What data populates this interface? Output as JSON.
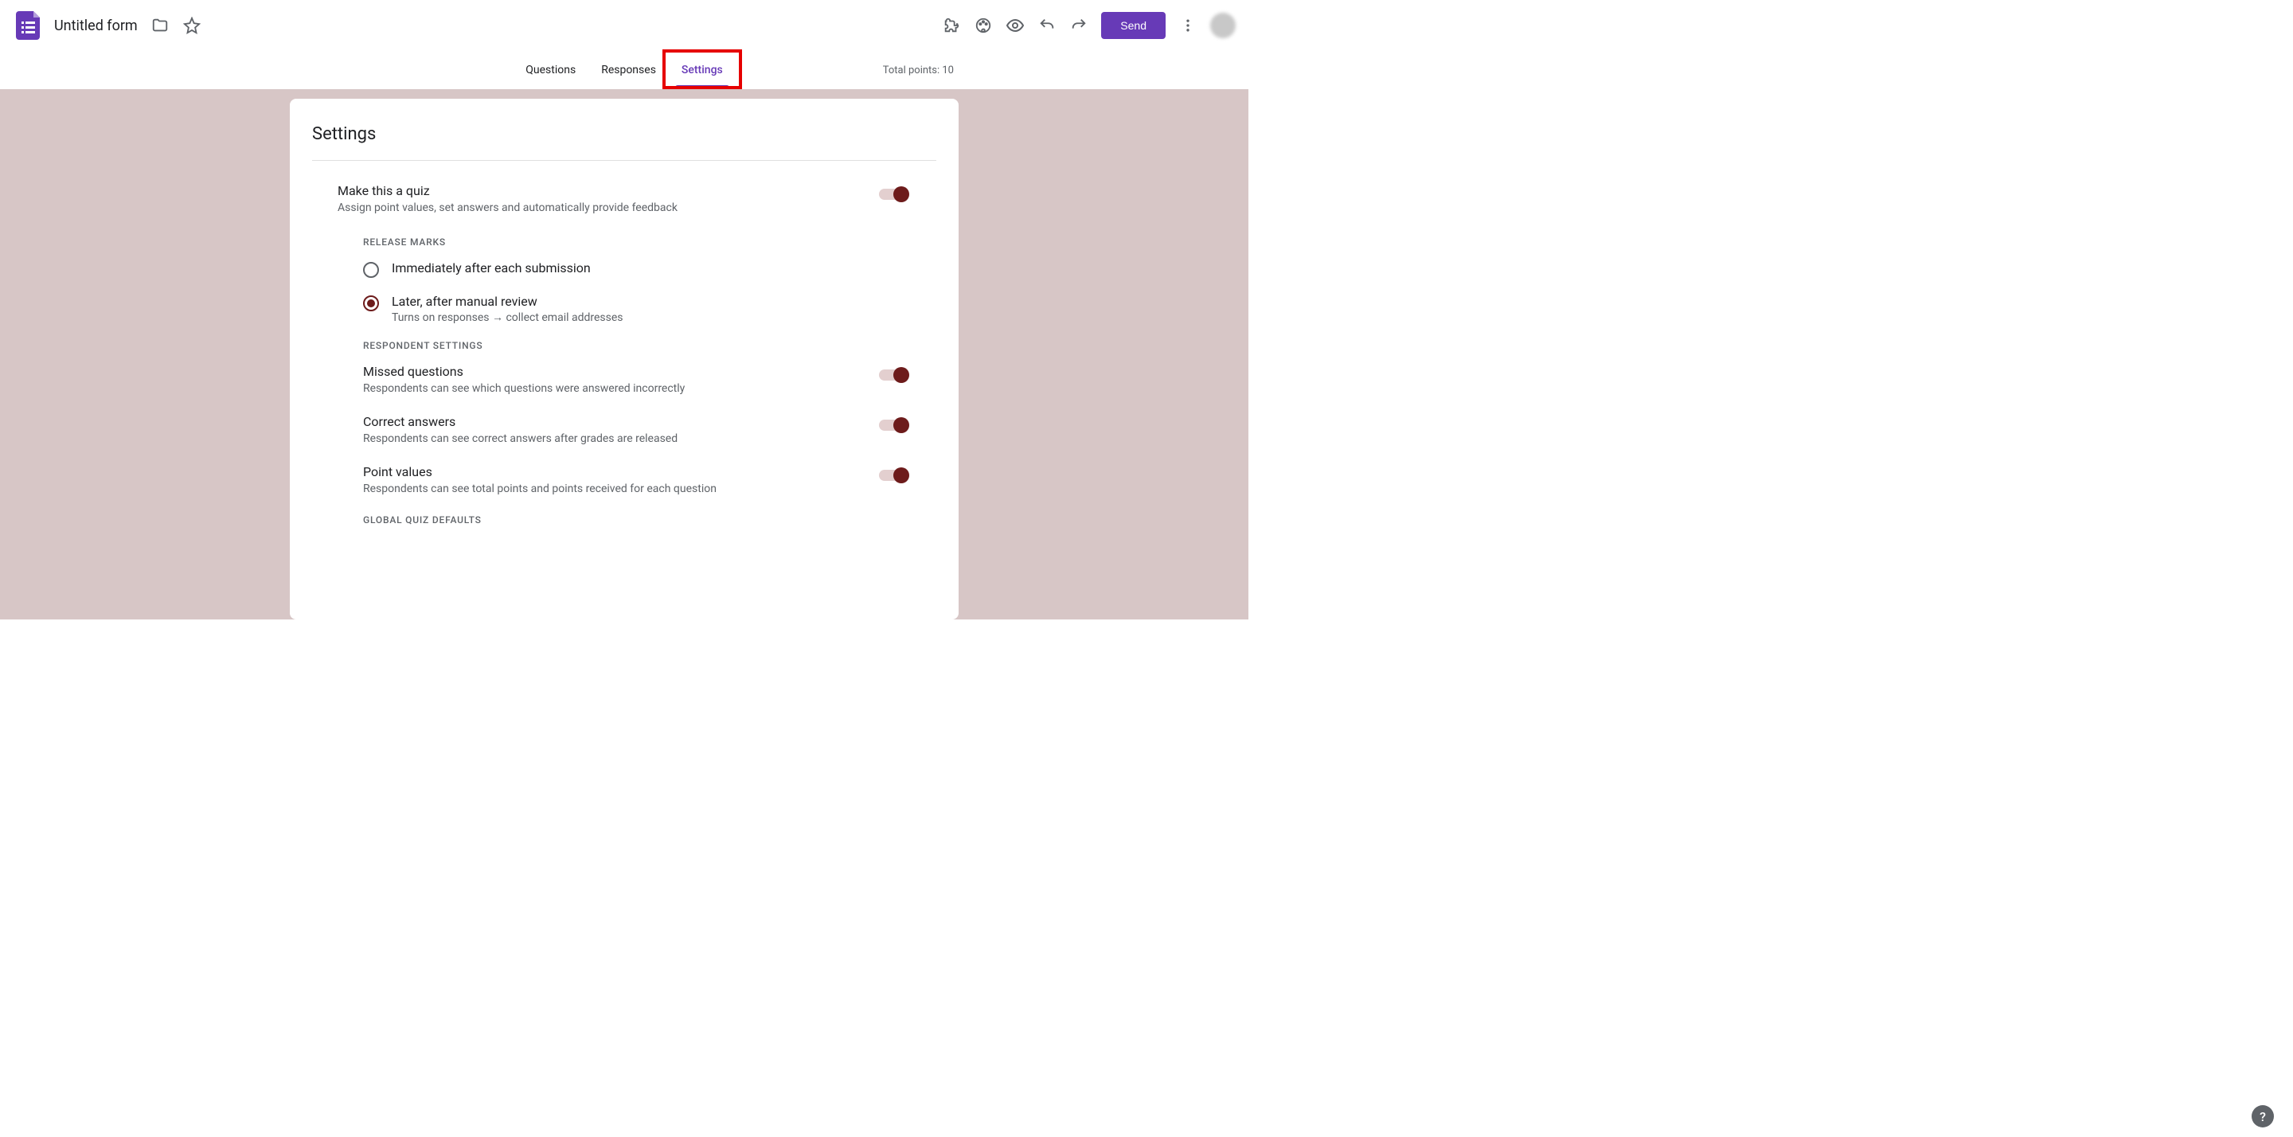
{
  "header": {
    "form_title": "Untitled form",
    "send_label": "Send"
  },
  "tabs": {
    "questions": "Questions",
    "responses": "Responses",
    "settings": "Settings"
  },
  "total_points_label": "Total points: 10",
  "settings_card": {
    "title": "Settings",
    "quiz": {
      "title": "Make this a quiz",
      "desc": "Assign point values, set answers and automatically provide feedback"
    },
    "release_marks_label": "RELEASE MARKS",
    "release_options": {
      "immediately": "Immediately after each submission",
      "later": "Later, after manual review",
      "later_desc": "Turns on responses → collect email addresses"
    },
    "respondent_label": "RESPONDENT SETTINGS",
    "missed": {
      "title": "Missed questions",
      "desc": "Respondents can see which questions were answered incorrectly"
    },
    "correct": {
      "title": "Correct answers",
      "desc": "Respondents can see correct answers after grades are released"
    },
    "points": {
      "title": "Point values",
      "desc": "Respondents can see total points and points received for each question"
    },
    "global_defaults_label": "GLOBAL QUIZ DEFAULTS"
  },
  "help_label": "?"
}
